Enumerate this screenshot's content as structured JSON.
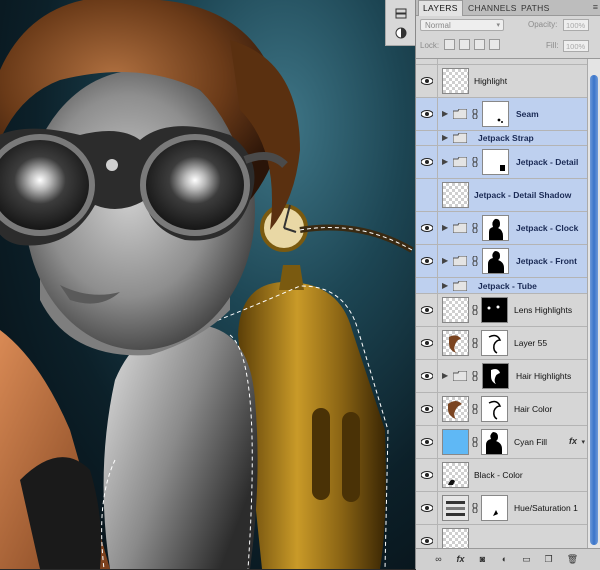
{
  "panel": {
    "tabs": [
      "LAYERS",
      "CHANNELS",
      "PATHS"
    ],
    "blend_mode": "Normal",
    "opacity_label": "Opacity:",
    "opacity_value": "100%",
    "lock_label": "Lock:",
    "fill_label": "Fill:",
    "fill_value": "100%"
  },
  "layers": [
    {
      "name": "Highlight",
      "type": "pixel",
      "selected": false,
      "bold": false
    },
    {
      "name": "Seam",
      "type": "group-mask",
      "selected": true,
      "bold": true
    },
    {
      "name": "Jetpack Strap",
      "type": "group",
      "selected": true,
      "bold": true
    },
    {
      "name": "Jetpack - Detail",
      "type": "group-mask",
      "selected": true,
      "bold": true
    },
    {
      "name": "Jetpack - Detail Shadow",
      "type": "pixel",
      "selected": true,
      "bold": true
    },
    {
      "name": "Jetpack - Clock",
      "type": "group-mask",
      "selected": true,
      "bold": true
    },
    {
      "name": "Jetpack - Front",
      "type": "group-mask",
      "selected": true,
      "bold": true
    },
    {
      "name": "Jetpack - Tube",
      "type": "group",
      "selected": true,
      "bold": true
    },
    {
      "name": "Lens Highlights",
      "type": "pixel-mask",
      "selected": false,
      "bold": false
    },
    {
      "name": "Layer 55",
      "type": "pixel-mask",
      "selected": false,
      "bold": false
    },
    {
      "name": "Hair Highlights",
      "type": "group-mask",
      "selected": false,
      "bold": false
    },
    {
      "name": "Hair Color",
      "type": "pixel-mask",
      "selected": false,
      "bold": false
    },
    {
      "name": "Cyan Fill",
      "type": "fill-mask",
      "selected": false,
      "bold": false,
      "fx": "fx"
    },
    {
      "name": "Black - Color",
      "type": "pixel",
      "selected": false,
      "bold": false
    },
    {
      "name": "Hue/Saturation 1",
      "type": "adjustment-mask",
      "selected": false,
      "bold": false
    }
  ],
  "colors": {
    "selection": "#bed0ef",
    "cyan_fill": "#5fb8f5",
    "scroll_thumb": "#3a74c9"
  },
  "icons": [
    "eye-icon",
    "folder-icon",
    "link-icon",
    "disclosure-triangle-icon",
    "fx-icon"
  ]
}
